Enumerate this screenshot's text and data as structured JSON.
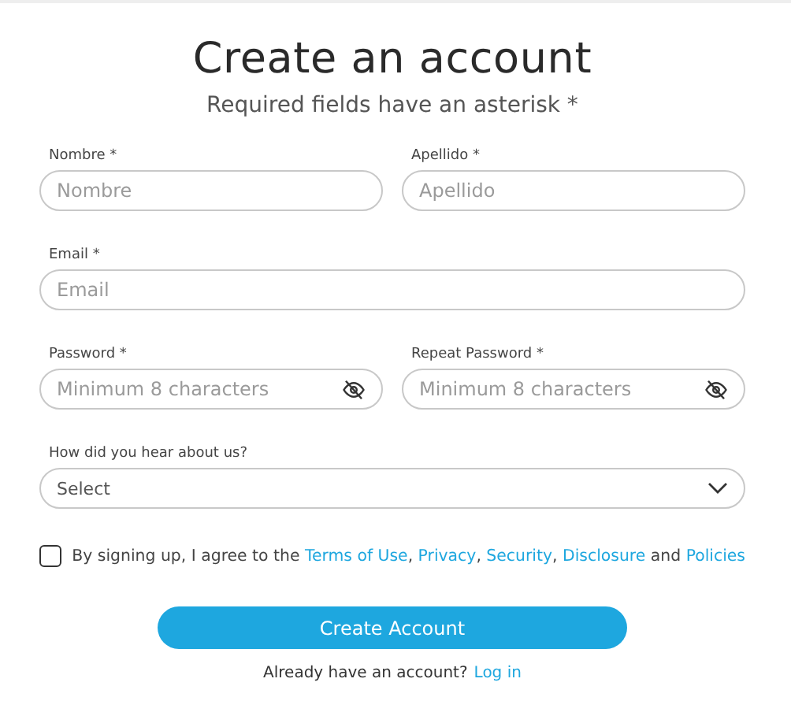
{
  "title": "Create an account",
  "subtitle": "Required fields have an asterisk *",
  "rows": [
    {
      "fields": [
        {
          "kind": "text",
          "label": "Nombre *",
          "placeholder": "Nombre"
        },
        {
          "kind": "text",
          "label": "Apellido *",
          "placeholder": "Apellido"
        }
      ]
    },
    {
      "fields": [
        {
          "kind": "text",
          "label": "Email *",
          "placeholder": "Email"
        }
      ]
    },
    {
      "fields": [
        {
          "kind": "password",
          "label": "Password *",
          "placeholder": "Minimum 8 characters"
        },
        {
          "kind": "password",
          "label": "Repeat Password *",
          "placeholder": "Minimum 8 characters"
        }
      ]
    },
    {
      "fields": [
        {
          "kind": "select",
          "label": "How did you hear about us?",
          "value": "Select"
        }
      ]
    }
  ],
  "agreement": {
    "checked": false,
    "lead": "By signing up, I agree to the ",
    "links": [
      {
        "text": "Terms of Use",
        "after": ", "
      },
      {
        "text": "Privacy",
        "after": ", "
      },
      {
        "text": "Security",
        "after": ", "
      },
      {
        "text": "Disclosure",
        "after": " and "
      },
      {
        "text": "Policies"
      }
    ]
  },
  "submit": "Create Account",
  "login": {
    "text": "Already have an account?",
    "link": "Log in"
  }
}
